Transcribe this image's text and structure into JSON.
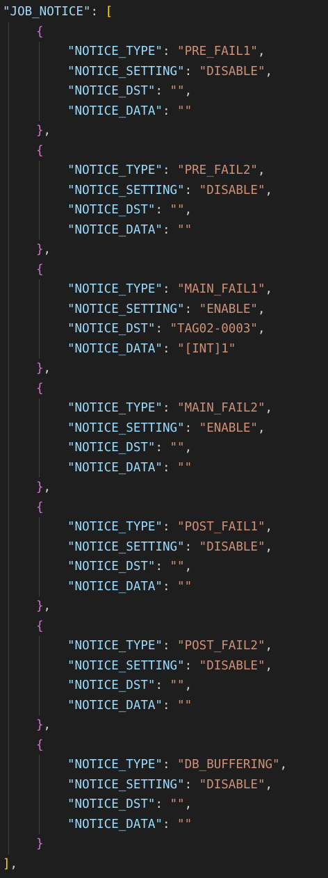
{
  "editor": {
    "root_key": "JOB_NOTICE",
    "field_keys": [
      "NOTICE_TYPE",
      "NOTICE_SETTING",
      "NOTICE_DST",
      "NOTICE_DATA"
    ],
    "entries": [
      {
        "type": "PRE_FAIL1",
        "setting": "DISABLE",
        "dst": "",
        "data": ""
      },
      {
        "type": "PRE_FAIL2",
        "setting": "DISABLE",
        "dst": "",
        "data": ""
      },
      {
        "type": "MAIN_FAIL1",
        "setting": "ENABLE",
        "dst": "TAG02-0003",
        "data": "[INT]1"
      },
      {
        "type": "MAIN_FAIL2",
        "setting": "ENABLE",
        "dst": "",
        "data": ""
      },
      {
        "type": "POST_FAIL1",
        "setting": "DISABLE",
        "dst": "",
        "data": ""
      },
      {
        "type": "POST_FAIL2",
        "setting": "DISABLE",
        "dst": "",
        "data": ""
      },
      {
        "type": "DB_BUFFERING",
        "setting": "DISABLE",
        "dst": "",
        "data": ""
      }
    ],
    "colors": {
      "background": "#1e1e1e",
      "key": "#9cdcfe",
      "string": "#ce9178",
      "punctuation": "#d4d4d4",
      "bracket_level1": "#ffd700",
      "bracket_level2": "#da70d6",
      "indent_guide": "#404040"
    }
  }
}
